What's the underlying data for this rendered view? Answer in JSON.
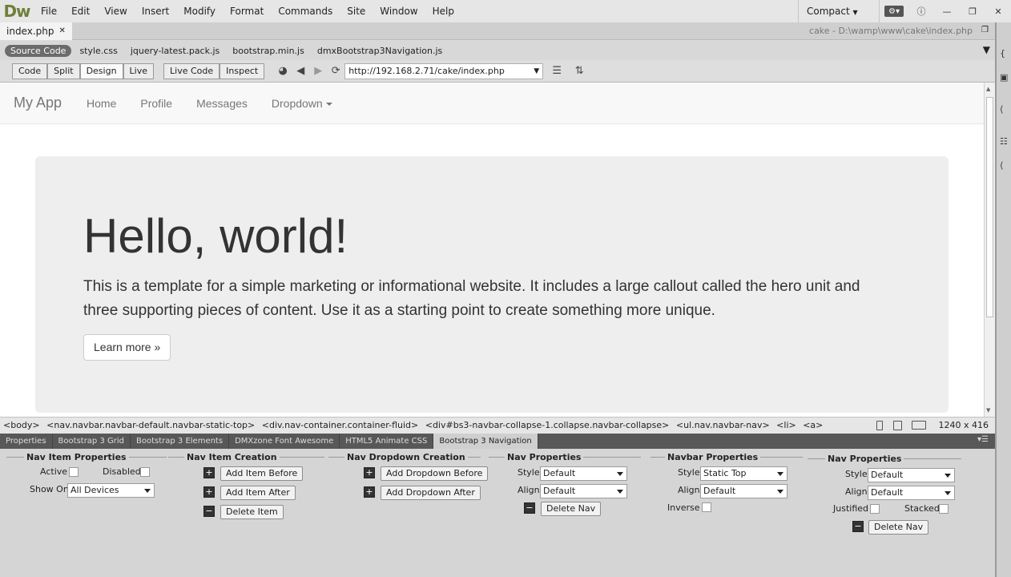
{
  "app": {
    "logo": "Dw",
    "menu": [
      "File",
      "Edit",
      "View",
      "Insert",
      "Modify",
      "Format",
      "Commands",
      "Site",
      "Window",
      "Help"
    ],
    "workspace": "Compact"
  },
  "document": {
    "tab_name": "index.php",
    "path": "cake - D:\\wamp\\www\\cake\\index.php"
  },
  "related_files": {
    "source_code": "Source Code",
    "files": [
      "style.css",
      "jquery-latest.pack.js",
      "bootstrap.min.js",
      "dmxBootstrap3Navigation.js"
    ]
  },
  "toolbar": {
    "views": [
      "Code",
      "Split",
      "Design",
      "Live"
    ],
    "active_view": "Design",
    "live_code": "Live Code",
    "inspect": "Inspect",
    "url": "http://192.168.2.71/cake/index.php"
  },
  "page": {
    "brand": "My App",
    "nav": [
      "Home",
      "Profile",
      "Messages",
      "Dropdown"
    ],
    "heading": "Hello, world!",
    "lead": "This is a template for a simple marketing or informational website. It includes a large callout called the hero unit and three supporting pieces of content. Use it as a starting point to create something more unique.",
    "button": "Learn more »"
  },
  "status": {
    "tags": [
      "<body>",
      "<nav.navbar.navbar-default.navbar-static-top>",
      "<div.nav-container.container-fluid>",
      "<div#bs3-navbar-collapse-1.collapse.navbar-collapse>",
      "<ul.nav.navbar-nav>",
      "<li>",
      "<a>"
    ],
    "window_size": "1240 x 416"
  },
  "panel_tabs": [
    "Properties",
    "Bootstrap 3 Grid",
    "Bootstrap 3 Elements",
    "DMXzone Font Awesome",
    "HTML5 Animate CSS",
    "Bootstrap 3 Navigation"
  ],
  "active_panel": "Bootstrap 3 Navigation",
  "props": {
    "nav_item": {
      "title": "Nav Item Properties",
      "active": "Active",
      "disabled": "Disabled",
      "show_on_label": "Show On",
      "show_on_value": "All Devices"
    },
    "item_creation": {
      "title": "Nav Item Creation",
      "before": "Add Item Before",
      "after": "Add Item After",
      "delete": "Delete Item"
    },
    "dropdown_creation": {
      "title": "Nav Dropdown Creation",
      "before": "Add Dropdown Before",
      "after": "Add Dropdown After"
    },
    "nav_props": {
      "title": "Nav Properties",
      "style_label": "Style",
      "style_value": "Default",
      "align_label": "Align",
      "align_value": "Default",
      "delete": "Delete Nav"
    },
    "navbar_props": {
      "title": "Navbar Properties",
      "style_label": "Style",
      "style_value": "Static Top",
      "align_label": "Align",
      "align_value": "Default",
      "inverse": "Inverse"
    },
    "nav_props2": {
      "title": "Nav Properties",
      "style_label": "Style",
      "style_value": "Default",
      "align_label": "Align",
      "align_value": "Default",
      "justified": "Justified",
      "stacked": "Stacked",
      "delete": "Delete Nav"
    }
  }
}
